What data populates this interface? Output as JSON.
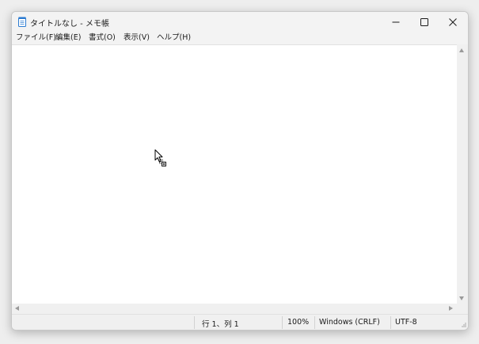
{
  "window": {
    "title": "タイトルなし - メモ帳",
    "app_icon": "notepad-icon"
  },
  "controls": {
    "minimize_icon": "minimize-icon",
    "maximize_icon": "maximize-icon",
    "close_icon": "close-icon"
  },
  "menu": {
    "items": [
      {
        "label": "ファイル(F)"
      },
      {
        "label": "編集(E)"
      },
      {
        "label": "書式(O)"
      },
      {
        "label": "表示(V)"
      },
      {
        "label": "ヘルプ(H)"
      }
    ]
  },
  "editor": {
    "content": "",
    "cursor_icon": "arrow-copy-cursor-icon"
  },
  "statusbar": {
    "position": "行 1、列 1",
    "zoom": "100%",
    "line_ending": "Windows (CRLF)",
    "encoding": "UTF-8"
  },
  "colors": {
    "chrome": "#f3f3f3",
    "editor_bg": "#ffffff",
    "icon_accent": "#2b7bd1"
  }
}
